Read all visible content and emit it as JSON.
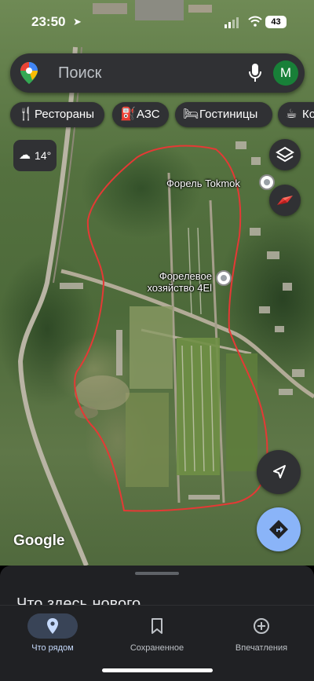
{
  "status_bar": {
    "time": "23:50",
    "battery": "43"
  },
  "search": {
    "placeholder": "Поиск",
    "avatar_letter": "M"
  },
  "chips": [
    {
      "label": "Рестораны",
      "icon": "fork-knife-icon"
    },
    {
      "label": "АЗС",
      "icon": "fuel-pump-icon"
    },
    {
      "label": "Гостиницы",
      "icon": "bed-icon"
    },
    {
      "label": "Ко",
      "icon": "coffee-cup-icon"
    }
  ],
  "weather": {
    "temperature": "14°",
    "icon": "partly-cloudy-night-icon"
  },
  "map": {
    "places": [
      {
        "name": "Форель Tokmok"
      },
      {
        "name": "Форелевое\nхозяйство 4El"
      }
    ],
    "outline_color": "#e53935",
    "logo": "Google"
  },
  "sheet": {
    "heading": "Что здесь нового"
  },
  "tabs": [
    {
      "label": "Что рядом",
      "icon": "location-pin-icon",
      "active": true
    },
    {
      "label": "Сохраненное",
      "icon": "bookmark-icon",
      "active": false
    },
    {
      "label": "Впечатления",
      "icon": "plus-circle-icon",
      "active": false
    }
  ],
  "colors": {
    "accent": "#8ab4f8",
    "surface": "#303134",
    "sheet": "#202124"
  }
}
